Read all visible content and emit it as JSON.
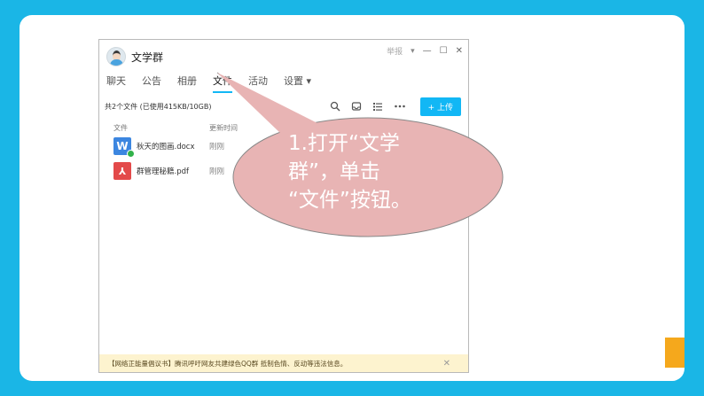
{
  "window": {
    "group_name": "文学群",
    "report_label": "举报",
    "dropdown_glyph": "▾",
    "minimize_glyph": "—",
    "maximize_glyph": "☐",
    "close_glyph": "✕"
  },
  "tabs": [
    {
      "label": "聊天"
    },
    {
      "label": "公告"
    },
    {
      "label": "相册"
    },
    {
      "label": "文件",
      "active": true
    },
    {
      "label": "活动"
    },
    {
      "label": "设置 ▾"
    }
  ],
  "toolbar": {
    "file_count": "共2个文件 (已使用415KB/10GB)",
    "upload_label": "+ 上传",
    "icons": [
      "search-icon",
      "inbox-icon",
      "list-icon",
      "more-icon"
    ]
  },
  "columns": {
    "name": "文件",
    "time": "更新时间"
  },
  "files": [
    {
      "icon_letter": "W",
      "name": "秋天的图画.docx",
      "time": "刚刚",
      "type": "word"
    },
    {
      "icon_letter": "⅄",
      "name": "群管理秘籍.pdf",
      "time": "刚刚",
      "type": "pdf"
    }
  ],
  "banner": {
    "text": "【网络正能量倡议书】腾讯呼吁网友共建绿色QQ群 抵制色情、反动等违法信息。",
    "close_glyph": "✕"
  },
  "callout": {
    "line1": "1.打开“文学",
    "line2": "群”，单击",
    "line3": "“文件”按钮。"
  },
  "colors": {
    "background": "#1ab6e6",
    "accent": "#f5a81c",
    "callout_fill": "#e8b4b4",
    "tab_active": "#12b7f5"
  }
}
